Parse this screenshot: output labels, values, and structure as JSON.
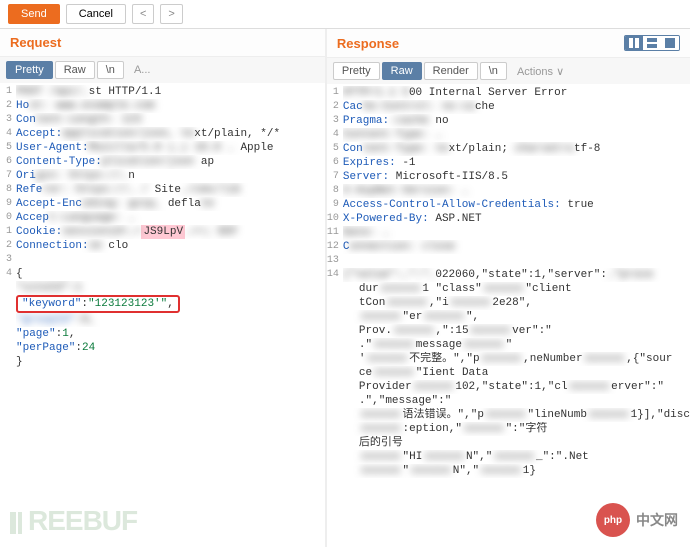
{
  "toolbar": {
    "send": "Send",
    "cancel": "Cancel",
    "prev": "<",
    "next": ">"
  },
  "request": {
    "title": "Request",
    "tabs": {
      "pretty": "Pretty",
      "raw": "Raw",
      "n": "\\n",
      "a": "A..."
    },
    "lines": [
      {
        "n": "1",
        "pre": "",
        "blur": "POST /api/…",
        "post": "st HTTP/1.1"
      },
      {
        "n": "2",
        "kw": "Ho",
        "blur": "st: www.example.com"
      },
      {
        "n": "3",
        "kw": "Con",
        "blur": "tent-Length: 123"
      },
      {
        "n": "4",
        "kw": "Accept:",
        "blur": " application/json, te",
        "post": "xt/plain, */*"
      },
      {
        "n": "5",
        "kw": "User-Agent:",
        "blur": " Mozilla/5.0 (…) 10.0 …",
        "post": " Apple"
      },
      {
        "n": "6",
        "kw": "Content-Type:",
        "post": " ap",
        "blur": "plication/json"
      },
      {
        "n": "7",
        "kw": "Ori",
        "blur": "gin: https://…",
        "post": "n"
      },
      {
        "n": "8",
        "kw": "Refe",
        "blur": "rer: https://… /",
        "post": " Site",
        "blur2": "…/cms/lib"
      },
      {
        "n": "9",
        "kw": "Accept-Enc",
        "blur": "oding: gzip,",
        "post": " defla",
        "blur2": "te"
      },
      {
        "n": "0",
        "kw": "Accep",
        "blur": "t-Language: …"
      },
      {
        "n": "1",
        "kw": "Cookie:",
        "blur": " sessionid=…=",
        "hl": "JS9LpV",
        "blur2": "…==; EEF"
      },
      {
        "n": "2",
        "kw": "Connection:",
        "post": " clo",
        "blur": "se"
      },
      {
        "n": "3",
        "post": ""
      },
      {
        "n": "4",
        "post": "{"
      }
    ],
    "body": {
      "siteId": "\"siteId\":1",
      "keyword": "\"keyword\":\"123123123'\",",
      "groupid": "\"groupId\":0,",
      "page": "\"page\":1,",
      "perPage": "\"perPage\":24",
      "close": "}"
    }
  },
  "response": {
    "title": "Response",
    "tabs": {
      "pretty": "Pretty",
      "raw": "Raw",
      "render": "Render",
      "n": "\\n",
      "actions": "Actions ∨"
    },
    "lines": [
      {
        "n": "1",
        "blur": "HTTP/1.1 5",
        "post": "00 Internal Server Error"
      },
      {
        "n": "2",
        "kw": "Cac",
        "blur": "he-Control: no-ca",
        "post": "che"
      },
      {
        "n": "3",
        "kw": "Pragma:",
        "post": " no",
        "blur": "-cache"
      },
      {
        "n": "4",
        "blur": "Content-Type: …"
      },
      {
        "n": "5",
        "kw": "Con",
        "blur": "tent-Type: te",
        "post": "xt/plain; ",
        "blur2": "charset=u",
        "post2": "tf-8"
      },
      {
        "n": "6",
        "kw": "Expires:",
        "post": " -1"
      },
      {
        "n": "7",
        "kw": "Server:",
        "post": " Microsoft-IIS/8.5"
      },
      {
        "n": "8",
        "blur": "X-AspNet-Version: …"
      },
      {
        "n": "9",
        "kw": "Access-Control-Allow-Credentials:",
        "post": " true"
      },
      {
        "n": "10",
        "kw": "X-Powered-By:",
        "post": " ASP.NET"
      },
      {
        "n": "11",
        "blur": "Date: …"
      },
      {
        "n": "12",
        "kw": "C",
        "blur": "onnection: close"
      },
      {
        "n": "13",
        "post": ""
      },
      {
        "n": "14",
        "blur": "{\"value\":…\":\"…",
        "post": "022060,\"state\":1,\"server\":",
        "blur2": "…\"proce"
      }
    ],
    "cont": [
      "dur                  1 \"class\"       \"client",
      "tCon                                   ,\"i        2e28\",",
      "  \"er                                  \",",
      "Prov.                              ,\":15    ver\":\"",
      ".\"   message                 \"",
      " '       不完整。\",\"p                 ,neNumber   ,{\"sour",
      "ce                  \"Iient Data",
      "Provider      102,\"state\":1,\"cl         erver\":\"",
      ".\",\"message\":\"",
      "     语法错误。\",\"p              \"lineNumb     1}],\"disc",
      "                  :eption,\"             \":\"字符",
      "后的引号",
      "                         \"HI   N\",\"      _\":\".Net",
      "   \"                          N\",\"           1}"
    ]
  },
  "watermark": "REEBUF",
  "logo": {
    "circ": "php",
    "txt": "中文网"
  }
}
